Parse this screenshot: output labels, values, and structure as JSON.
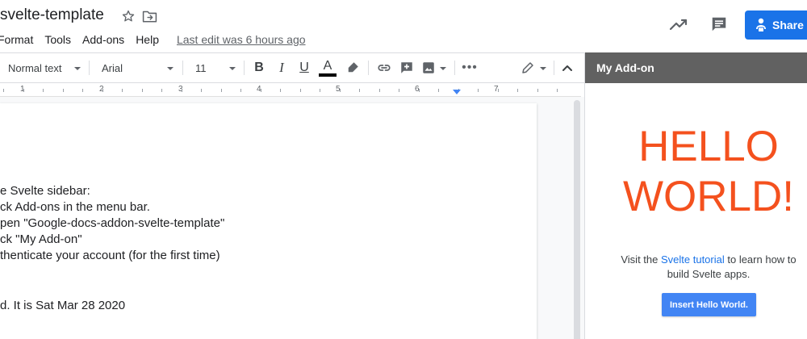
{
  "header": {
    "title": "svelte-template",
    "menu": [
      "Format",
      "Tools",
      "Add-ons",
      "Help"
    ],
    "last_edit": "Last edit was 6 hours ago",
    "share_label": "Share"
  },
  "toolbar": {
    "style": "Normal text",
    "font": "Arial",
    "size": "11"
  },
  "ruler": {
    "numbers": [
      "1",
      "2",
      "3",
      "4",
      "5",
      "6",
      "7"
    ]
  },
  "document": {
    "lines": [
      "e Svelte sidebar:",
      "ck Add-ons in the menu bar.",
      "pen \"Google-docs-addon-svelte-template\"",
      "ck \"My Add-on\"",
      "thenticate your account (for the first time)",
      "d. It is Sat Mar 28 2020"
    ]
  },
  "sidebar": {
    "title": "My Add-on",
    "hello_line1": "HELLO",
    "hello_line2": "WORLD!",
    "visit_prefix": "Visit the ",
    "visit_link": "Svelte tutorial",
    "visit_suffix_1": " to learn how to",
    "visit_suffix_2": "build Svelte apps.",
    "insert_button": "Insert Hello World."
  },
  "colors": {
    "accent": "#1a73e8",
    "hello": "#f4511e",
    "sidebar_header": "#616161",
    "insert_button": "#4285f4"
  }
}
